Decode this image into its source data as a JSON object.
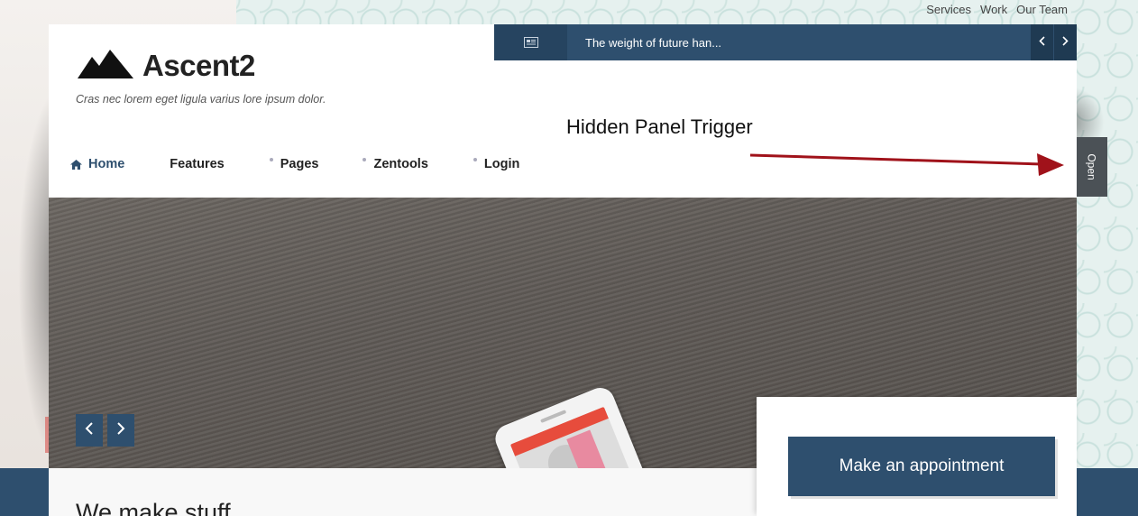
{
  "top_links": [
    "Services",
    "Work",
    "Our Team"
  ],
  "logo": {
    "title": "Ascent2",
    "tagline": "Cras nec lorem eget ligula varius lore ipsum dolor."
  },
  "nav": {
    "items": [
      {
        "label": "Home",
        "icon": "home-icon"
      },
      {
        "label": "Features"
      },
      {
        "label": "Pages"
      },
      {
        "label": "Zentools"
      },
      {
        "label": "Login"
      }
    ]
  },
  "ticker": {
    "icon": "newspaper-icon",
    "text": "The weight of future han..."
  },
  "annotation": "Hidden Panel Trigger",
  "hidden_panel": {
    "label": "Open"
  },
  "content": {
    "title": "We make stuff"
  },
  "appointment": {
    "label": "Make an appointment"
  },
  "colors": {
    "brand": "#2e4f6e",
    "annotation_arrow": "#a0121a",
    "open_tab": "#4b5156"
  }
}
